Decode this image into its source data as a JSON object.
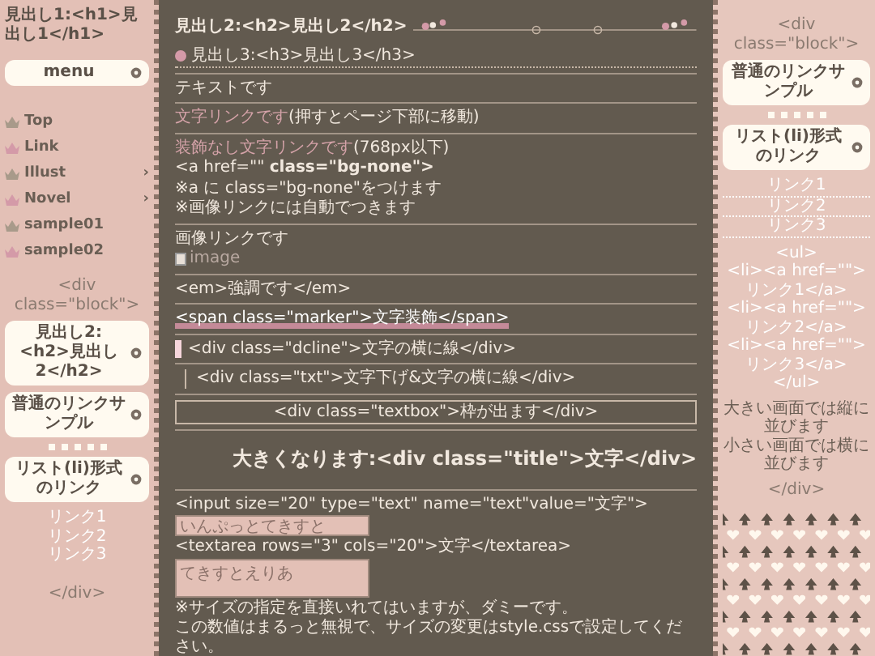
{
  "left": {
    "title": "見出し1:<h1>見出し1</h1>",
    "menu_heading": "menu",
    "menu": [
      {
        "label": "Top",
        "color": "#a89a8a"
      },
      {
        "label": "Link",
        "color": "#d49aa8"
      },
      {
        "label": "Illust",
        "submenu_mark": "›",
        "color": "#a89a8a"
      },
      {
        "label": "Novel",
        "submenu_mark": "›",
        "color": "#d49aa8"
      },
      {
        "label": "sample01",
        "color": "#a89a8a"
      },
      {
        "label": "sample02",
        "color": "#d49aa8"
      }
    ],
    "block_open": "<div class=\"block\">",
    "heading_a": "見出し2:<h2>見出し2</h2>",
    "heading_b": "普通のリンクサンプル",
    "heading_c": "リスト(li)形式のリンク",
    "links": [
      "リンク1",
      "リンク2",
      "リンク3"
    ],
    "block_close": "</div>"
  },
  "main": [
    {
      "kind": "h2",
      "text": "見出し2:<h2>見出し2</h2>"
    },
    {
      "kind": "h3",
      "text": "見出し3:<h3>見出し3</h3>"
    },
    {
      "kind": "text",
      "text": "テキストです"
    },
    {
      "kind": "link",
      "link": "文字リンクです",
      "text": "(押すとページ下部に移動)"
    },
    {
      "kind": "lines",
      "link": "装飾なし文字リンクです",
      "text": "(768px以下)",
      "lines": [
        "<a href=\"\" **class=\"bg-none\">**",
        "※a に class=\"bg-none\"をつけます",
        "※画像リンクには自動でつきます"
      ]
    },
    {
      "kind": "image",
      "text": "画像リンクです",
      "alt": "image"
    },
    {
      "kind": "text",
      "text": "<em>強調です</em>"
    },
    {
      "kind": "marker",
      "text": "<span class=\"marker\">文字装飾</span>"
    },
    {
      "kind": "dcline",
      "text": "<div class=\"dcline\">文字の横に線</div>"
    },
    {
      "kind": "txt",
      "text": "<div class=\"txt\">文字下げ&文字の横に線</div>"
    },
    {
      "kind": "textbox",
      "text": "<div class=\"textbox\">枠が出ます</div>"
    },
    {
      "kind": "title",
      "text": "大きくなります:<div class=\"title\">文字</div>"
    },
    {
      "kind": "form",
      "input_label": "<input size=\"20\" type=\"text\" name=\"text\"value=\"文字\">",
      "input_value": "いんぷっとてきすと",
      "textarea_label": "<textarea rows=\"3\" cols=\"20\">文字</textarea>",
      "textarea_value": "てきすとえりあ",
      "notes": [
        "※サイズの指定を直接いれてはいますが、ダミーです。",
        "この数値はまるっと無視で、サイズの変更はstyle.cssで設定してください。"
      ]
    }
  ],
  "right": {
    "block_open": "<div class=\"block\">",
    "heading_b": "普通のリンクサンプル",
    "heading_c": "リスト(li)形式のリンク",
    "links": [
      "リンク1",
      "リンク2",
      "リンク3"
    ],
    "code": [
      "<ul>",
      "<li><a href=\"\">リンク1</a>",
      "<li><a href=\"\">リンク2</a>",
      "<li><a href=\"\">リンク3</a>",
      "</ul>"
    ],
    "notes": [
      "大きい画面では縦に並びます",
      "小さい画面では横に並びます"
    ],
    "block_close": "</div>"
  }
}
